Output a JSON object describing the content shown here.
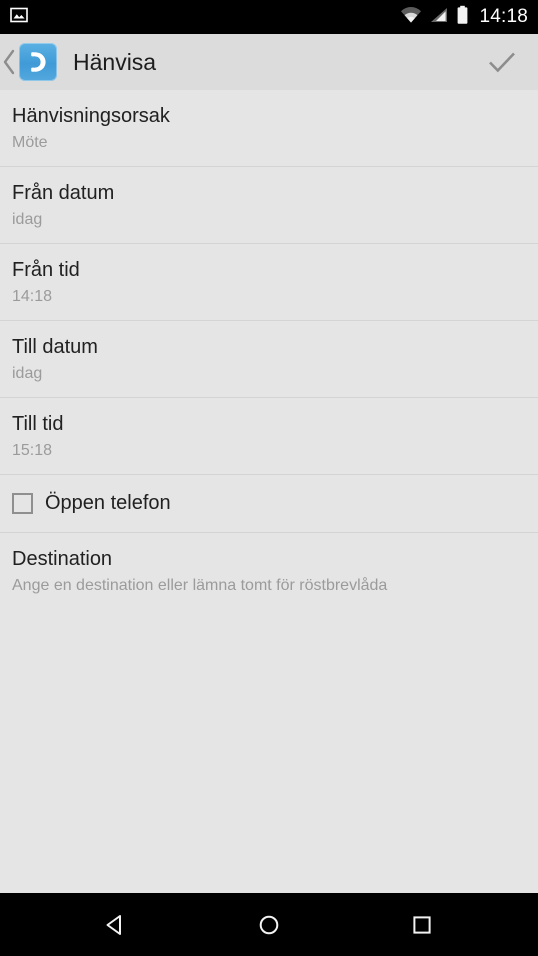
{
  "status_bar": {
    "notification_icon": "image-notification-icon",
    "wifi_icon": "wifi-icon",
    "signal_icon": "signal-icon",
    "battery_icon": "battery-icon",
    "clock": "14:18"
  },
  "action_bar": {
    "back_icon": "back-chevron-icon",
    "app_icon": "phone-handset-icon",
    "title": "Hänvisa",
    "confirm_icon": "checkmark-icon"
  },
  "preferences": [
    {
      "title": "Hänvisningsorsak",
      "summary": "Möte"
    },
    {
      "title": "Från datum",
      "summary": "idag"
    },
    {
      "title": "Från tid",
      "summary": "14:18"
    },
    {
      "title": "Till datum",
      "summary": "idag"
    },
    {
      "title": "Till tid",
      "summary": "15:18"
    }
  ],
  "open_phone": {
    "label": "Öppen telefon",
    "checked": false
  },
  "destination": {
    "title": "Destination",
    "summary": "Ange en destination eller lämna tomt för röstbrevlåda"
  },
  "nav_bar": {
    "back": "back-triangle-icon",
    "home": "home-circle-icon",
    "recents": "recents-square-icon"
  },
  "colors": {
    "accent_blue": "#3f9ad6",
    "background": "#e5e5e5",
    "action_bar": "#dcdcdc",
    "primary_text": "#212121",
    "secondary_text": "#9b9b9b",
    "system_bar": "#000000"
  }
}
